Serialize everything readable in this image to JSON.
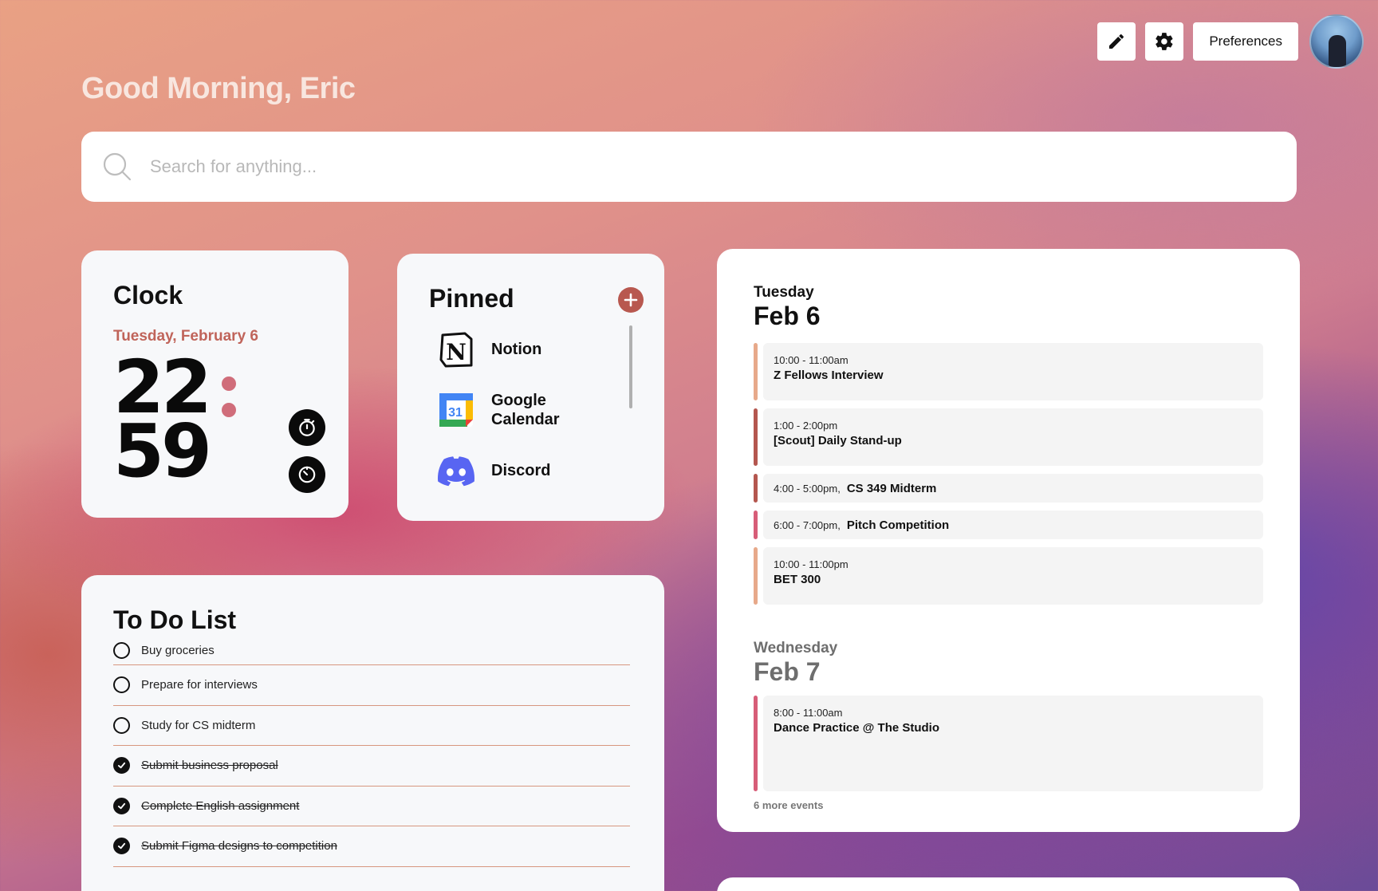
{
  "greeting": "Good Morning, Eric",
  "topbar": {
    "edit_icon": "pencil-icon",
    "settings_icon": "gear-icon",
    "preferences_label": "Preferences"
  },
  "search": {
    "placeholder": "Search for anything..."
  },
  "clock": {
    "title": "Clock",
    "date": "Tuesday, February 6",
    "hours": "22",
    "minutes": "59"
  },
  "pinned": {
    "title": "Pinned",
    "items": [
      {
        "label": "Notion",
        "icon": "notion-icon"
      },
      {
        "label": "Google Calendar",
        "icon": "google-calendar-icon"
      },
      {
        "label": "Discord",
        "icon": "discord-icon"
      }
    ]
  },
  "todo": {
    "title": "To Do List",
    "items": [
      {
        "text": "Buy groceries",
        "done": false
      },
      {
        "text": "Prepare for interviews",
        "done": false
      },
      {
        "text": "Study for CS midterm",
        "done": false
      },
      {
        "text": "Submit business proposal",
        "done": true
      },
      {
        "text": "Complete English assignment",
        "done": true
      },
      {
        "text": "Submit Figma designs to competition",
        "done": true
      }
    ]
  },
  "calendar": {
    "days": [
      {
        "weekday": "Tuesday",
        "date": "Feb 6",
        "events": [
          {
            "time": "10:00 - 11:00am",
            "name": "Z Fellows Interview",
            "color": "#e7a98a"
          },
          {
            "time": "1:00 - 2:00pm",
            "name": "[Scout] Daily Stand-up",
            "color": "#b4574f"
          },
          {
            "time": "4:00 - 5:00pm,",
            "name": "CS 349 Midterm",
            "color": "#b4574f"
          },
          {
            "time": "6:00 - 7:00pm,",
            "name": "Pitch Competition",
            "color": "#d75d78"
          },
          {
            "time": "10:00 - 11:00pm",
            "name": "BET 300",
            "color": "#e7a98a"
          }
        ]
      },
      {
        "weekday": "Wednesday",
        "date": "Feb 7",
        "events": [
          {
            "time": "8:00 - 11:00am",
            "name": "Dance Practice @ The Studio",
            "color": "#d75d78"
          }
        ]
      }
    ],
    "more": "6 more events"
  }
}
